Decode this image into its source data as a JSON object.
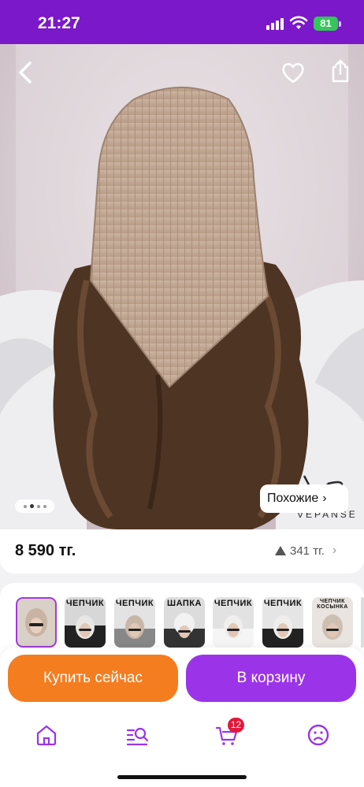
{
  "status_bar": {
    "time": "21:27",
    "battery": "81"
  },
  "hero": {
    "similar_label": "Похожие",
    "brand": "VEPANSE",
    "image_count": 4,
    "current_image": 2
  },
  "price": {
    "value": "8 590 тг.",
    "change": "341 тг."
  },
  "thumbnails": [
    {
      "title": ""
    },
    {
      "title": "ЧЕПЧИК"
    },
    {
      "title": "ЧЕПЧИК"
    },
    {
      "title": "ШАПКА"
    },
    {
      "title": "ЧЕПЧИК"
    },
    {
      "title": "ЧЕПЧИК"
    },
    {
      "title": "ЧЕПЧИК КОСЫНКА"
    },
    {
      "title": ""
    }
  ],
  "actions": {
    "buy_now": "Купить сейчас",
    "add_to_cart": "В корзину"
  },
  "tabbar": {
    "items": [
      {
        "icon": "home-icon"
      },
      {
        "icon": "catalog-search-icon"
      },
      {
        "icon": "cart-icon",
        "badge": "12"
      },
      {
        "icon": "profile-icon"
      }
    ]
  },
  "colors": {
    "brand_purple": "#7b18c9",
    "buy_orange": "#f47d20",
    "cart_purple": "#9b34e8",
    "badge_red": "#e4173a",
    "tab_active": "#9b34e8"
  }
}
